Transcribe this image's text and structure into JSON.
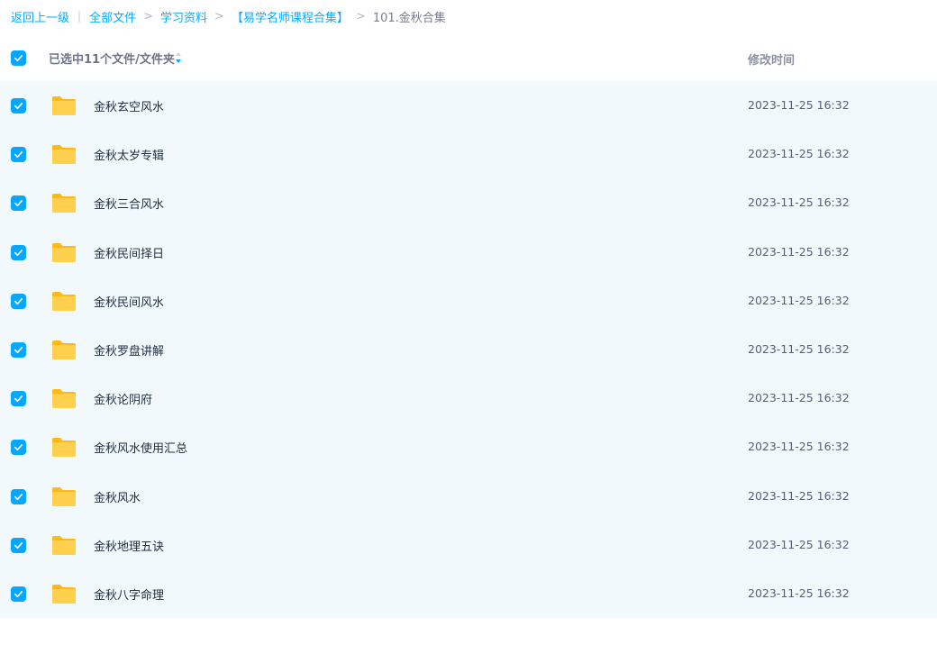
{
  "breadcrumb": {
    "back": "返回上一级",
    "separator_bar": "|",
    "separator_gt": ">",
    "items": [
      "全部文件",
      "学习资料",
      "【易学名师课程合集】"
    ],
    "current": "101.金秋合集"
  },
  "header": {
    "selected_label": "已选中11个文件/文件夹",
    "time_label": "修改时间"
  },
  "colors": {
    "accent": "#06a7ff",
    "row_bg": "#f2f9fd",
    "folder": "#ffc634"
  },
  "files": [
    {
      "name": "金秋玄空风水",
      "modified": "2023-11-25 16:32"
    },
    {
      "name": "金秋太岁专辑",
      "modified": "2023-11-25 16:32"
    },
    {
      "name": "金秋三合风水",
      "modified": "2023-11-25 16:32"
    },
    {
      "name": "金秋民间择日",
      "modified": "2023-11-25 16:32"
    },
    {
      "name": "金秋民间风水",
      "modified": "2023-11-25 16:32"
    },
    {
      "name": "金秋罗盘讲解",
      "modified": "2023-11-25 16:32"
    },
    {
      "name": "金秋论阴府",
      "modified": "2023-11-25 16:32"
    },
    {
      "name": "金秋风水使用汇总",
      "modified": "2023-11-25 16:32"
    },
    {
      "name": "金秋风水",
      "modified": "2023-11-25 16:32"
    },
    {
      "name": "金秋地理五诀",
      "modified": "2023-11-25 16:32"
    },
    {
      "name": "金秋八字命理",
      "modified": "2023-11-25 16:32"
    }
  ]
}
